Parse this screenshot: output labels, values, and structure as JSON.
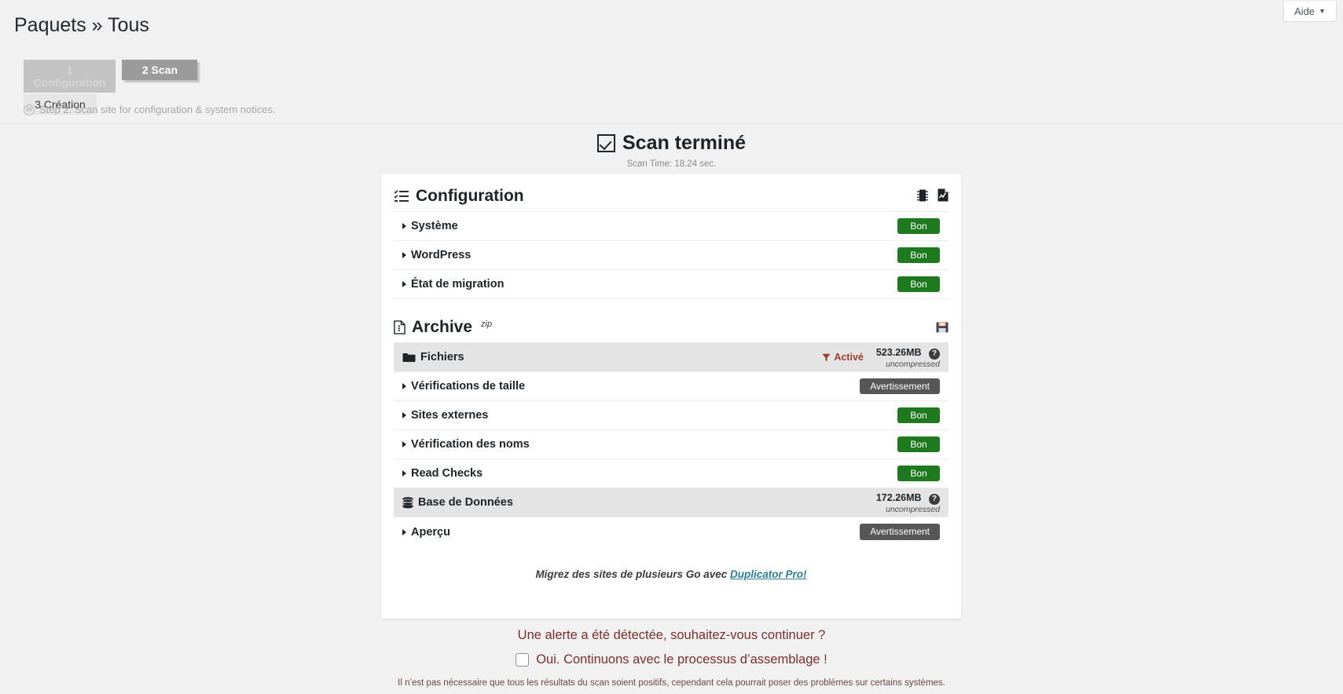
{
  "header": {
    "title": "Paquets » Tous",
    "help_label": "Aide",
    "help_caret": "▼"
  },
  "steps": {
    "tab1": "1 Configuration",
    "tab2": "2 Scan",
    "tab3": "3 Création",
    "note": "Step 2: Scan site for configuration & system notices.",
    "note_icon": "wordpress-icon"
  },
  "scan": {
    "title": "Scan terminé",
    "time": "Scan Time: 18.24 sec."
  },
  "configuration": {
    "title": "Configuration",
    "title_icon": "checklist-icon",
    "icons": [
      {
        "name": "server-icon"
      },
      {
        "name": "document-report-icon"
      }
    ],
    "rows": [
      {
        "label": "Système",
        "badge": "Bon",
        "badge_type": "good"
      },
      {
        "label": "WordPress",
        "badge": "Bon",
        "badge_type": "good"
      },
      {
        "label": "État de migration",
        "badge": "Bon",
        "badge_type": "good"
      }
    ]
  },
  "archive": {
    "title": "Archive",
    "title_sup": "zip",
    "title_icon": "file-icon",
    "save_icon": "floppy-disk-icon",
    "files_group": {
      "label": "Fichiers",
      "icon": "folder-icon",
      "filter_icon": "filter-icon",
      "filter_label": "Activé",
      "size": "523.26MB",
      "size_note": "uncompressed",
      "help_icon": "question-mark-icon",
      "help_glyph": "?"
    },
    "files_rows": [
      {
        "label": "Vérifications de taille",
        "badge": "Avertissement",
        "badge_type": "warn"
      },
      {
        "label": "Sites externes",
        "badge": "Bon",
        "badge_type": "good"
      },
      {
        "label": "Vérification des noms",
        "badge": "Bon",
        "badge_type": "good"
      },
      {
        "label": "Read Checks",
        "badge": "Bon",
        "badge_type": "good"
      }
    ],
    "db_group": {
      "label": "Base de Données",
      "icon": "database-icon",
      "size": "172.26MB",
      "size_note": "uncompressed",
      "help_icon": "question-mark-icon",
      "help_glyph": "?"
    },
    "db_rows": [
      {
        "label": "Aperçu",
        "badge": "Avertissement",
        "badge_type": "warn"
      }
    ],
    "promo_text": "Migrez des sites de plusieurs Go avec ",
    "promo_link": "Duplicator Pro!"
  },
  "footer": {
    "alert_question": "Une alerte a été détectée, souhaitez-vous continuer ?",
    "confirm_label": "Oui. Continuons avec le processus d’assemblage !",
    "checkbox_checked": false,
    "fine_print_line1": "Il n’est pas nécessaire que tous les résultats du scan soient positifs, cependant cela pourrait poser des problèmes sur certains systèmes."
  },
  "colors": {
    "badge_good": "#1f7a1f",
    "badge_warn": "#575757",
    "filter_red": "#a33a2e",
    "link": "#2a7f95",
    "footer_text": "#7a2f2f"
  }
}
